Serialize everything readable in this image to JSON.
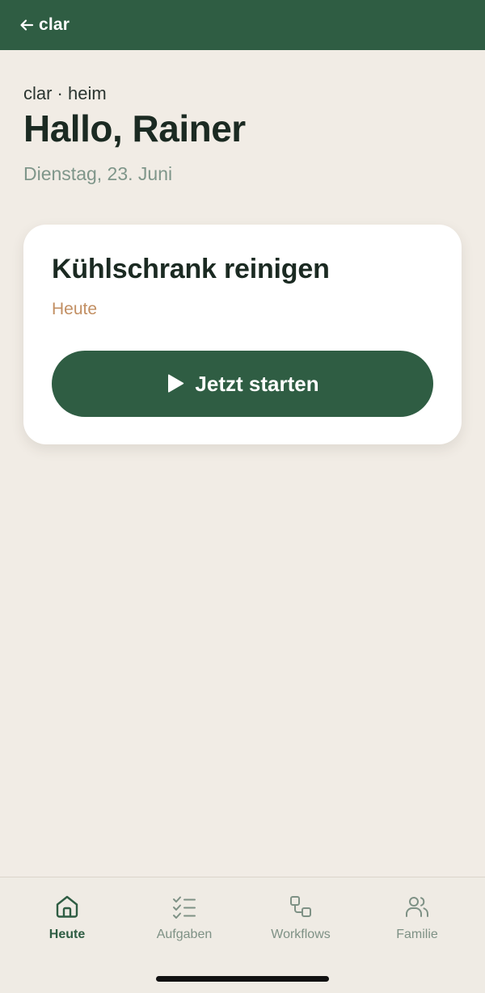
{
  "app": {
    "back_label": "clar"
  },
  "header": {
    "eyebrow": "clar · heim",
    "greeting": "Hallo, Rainer",
    "date": "Dienstag, 23. Juni"
  },
  "task": {
    "title": "Kühlschrank reinigen",
    "due": "Heute",
    "start_label": "Jetzt starten",
    "start_icon": "play-icon"
  },
  "nav": {
    "items": [
      {
        "label": "Heute",
        "icon": "home-icon",
        "active": true
      },
      {
        "label": "Aufgaben",
        "icon": "checklist-icon",
        "active": false
      },
      {
        "label": "Workflows",
        "icon": "workflow-icon",
        "active": false
      },
      {
        "label": "Familie",
        "icon": "users-icon",
        "active": false
      }
    ]
  },
  "colors": {
    "primary": "#2f5d43",
    "background": "#f1ece5",
    "card": "#ffffff",
    "accent_due": "#c28f63",
    "muted_text": "#7f968a",
    "nav_inactive": "#7e9185"
  }
}
